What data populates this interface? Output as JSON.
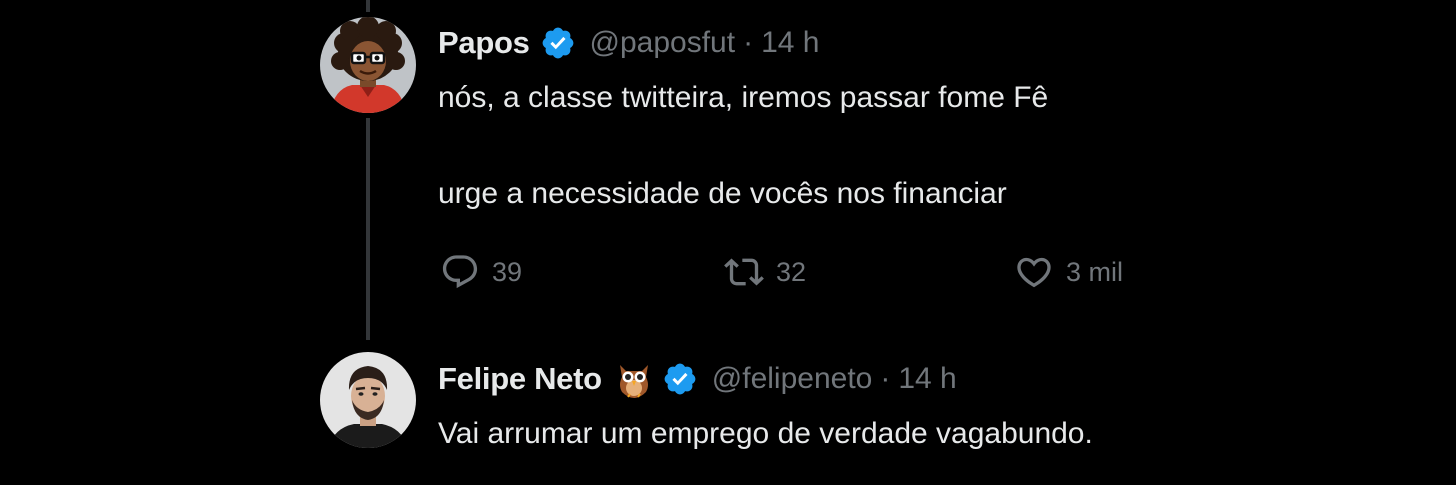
{
  "colors": {
    "background": "#000000",
    "primary_text": "#e7e9ea",
    "secondary_text": "#71767b",
    "verified_blue": "#1d9bf0",
    "thread_line": "#333639"
  },
  "tweets": [
    {
      "avatar_icon": "cartoon-avatar-icon",
      "display_name": "Papos",
      "verified_icon": "verified-badge-icon",
      "handle": "@paposfut",
      "separator": "·",
      "time": "14 h",
      "text_lines": [
        "nós, a classe twitteira, iremos passar fome Fê",
        "urge a necessidade de vocês nos financiar"
      ],
      "actions": {
        "reply": {
          "icon": "reply-icon",
          "count": "39"
        },
        "retweet": {
          "icon": "retweet-icon",
          "count": "32"
        },
        "like": {
          "icon": "heart-icon",
          "count": "3 mil"
        }
      }
    },
    {
      "avatar_icon": "photo-avatar-icon",
      "display_name": "Felipe Neto",
      "emoji_icon": "owl-emoji-icon",
      "verified_icon": "verified-badge-icon",
      "handle": "@felipeneto",
      "separator": "·",
      "time": "14 h",
      "text_lines": [
        "Vai arrumar um emprego de verdade vagabundo."
      ]
    }
  ]
}
